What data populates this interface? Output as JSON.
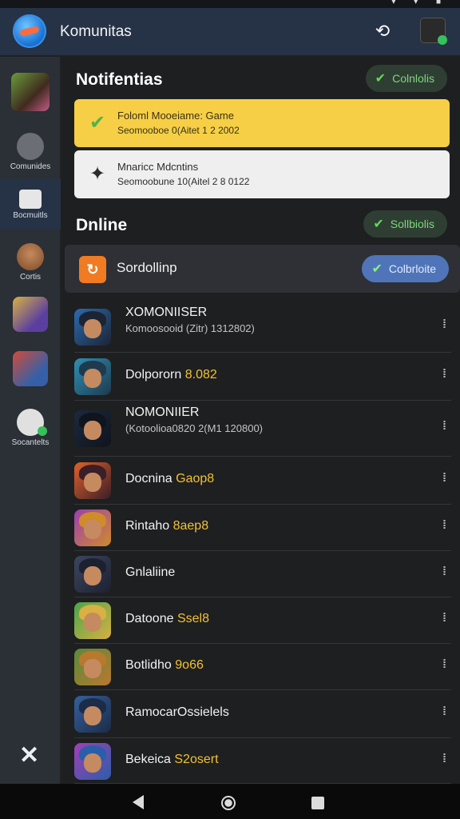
{
  "app": {
    "title": "Komunitas"
  },
  "sidebar": {
    "items": [
      {
        "label": "",
        "icon": "game-thumb"
      },
      {
        "label": "Comunides",
        "icon": "profile-icon"
      },
      {
        "label": "Bocmuitls",
        "icon": "box-icon"
      },
      {
        "label": "Cortis",
        "icon": "hero-icon"
      },
      {
        "label": "",
        "icon": "hero-icon"
      },
      {
        "label": "",
        "icon": "hero-icon"
      },
      {
        "label": "Socantelts",
        "icon": "chat-icon"
      }
    ],
    "close_icon": "close-icon"
  },
  "notifications": {
    "title": "Notifentias",
    "action_label": "Colnlolis",
    "items": [
      {
        "title": "Foloml Mooeiame: Game",
        "sub": "Seomooboe 0(Aitet 1 2 2002",
        "icon": "check-icon"
      },
      {
        "title": "Mnaricc Mdcntins",
        "sub": "Seomoobune 10(Aitel 2 8 0122",
        "icon": "ninja-icon"
      }
    ]
  },
  "online": {
    "title": "Dnline",
    "action_label": "Sollbiolis",
    "featured": {
      "label": "Sordollinp",
      "button": "Colbrloite",
      "icon": "link-icon"
    },
    "rows": [
      {
        "name": "XOMONIISER",
        "highlight": "",
        "sub": "Komoosooid (Zitr) 1312802)",
        "colors": [
          "#2b6bb0",
          "#1c2433"
        ]
      },
      {
        "name": "Dolpororn",
        "highlight": "8.082",
        "sub": "",
        "colors": [
          "#2f8fb3",
          "#1e3a4f"
        ]
      },
      {
        "name": "NOMONIIER",
        "highlight": "",
        "sub": "(Kotoolioa0820 2(M1 120800)",
        "colors": [
          "#1b2a3c",
          "#0f141d"
        ]
      },
      {
        "name": "Docnina",
        "highlight": "Gaop8",
        "sub": "",
        "colors": [
          "#e0612a",
          "#3a1e28"
        ]
      },
      {
        "name": "Rintaho",
        "highlight": "8aep8",
        "sub": "",
        "colors": [
          "#9b3fb0",
          "#d08b2a"
        ]
      },
      {
        "name": "Gnlaliine",
        "highlight": "",
        "sub": "",
        "colors": [
          "#3b4660",
          "#1c2130"
        ]
      },
      {
        "name": "Datoone",
        "highlight": "Ssel8",
        "sub": "",
        "colors": [
          "#4aa54a",
          "#d9b043"
        ]
      },
      {
        "name": "Botlidho",
        "highlight": "9o66",
        "sub": "",
        "colors": [
          "#5a8a3a",
          "#b8792f"
        ]
      },
      {
        "name": "RamocarOssielels",
        "highlight": "",
        "sub": "",
        "colors": [
          "#35609c",
          "#1a2c48"
        ]
      },
      {
        "name": "Bekeica",
        "highlight": "S2osert",
        "sub": "",
        "colors": [
          "#a13fb5",
          "#2b5ea8"
        ]
      }
    ]
  },
  "colors": {
    "accent": "#f6cf47",
    "appbar": "#263245",
    "online_pill": "#4f75b8"
  }
}
